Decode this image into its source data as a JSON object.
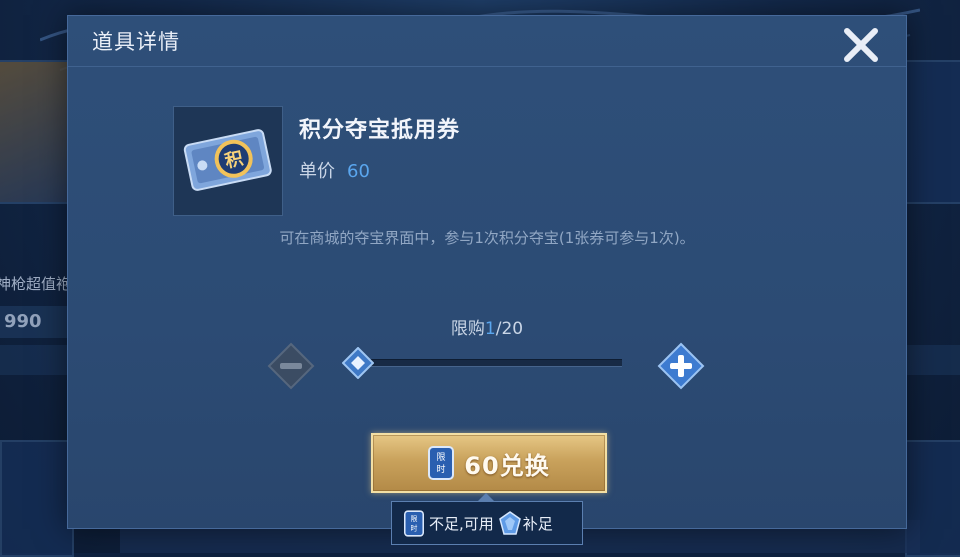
{
  "dialog": {
    "title": "道具详情",
    "close_icon": "close-x-icon"
  },
  "item": {
    "name": "积分夺宝抵用券",
    "price_label": "单价",
    "price_value": "60",
    "icon": "points-ticket-icon",
    "icon_char": "积",
    "description": "可在商城的夺宝界面中，参与1次积分夺宝(1张券可参与1次)。"
  },
  "purchase": {
    "limit_label": "限购",
    "limit_current": "1",
    "limit_total": "/20",
    "quantity_min": 1,
    "quantity_max": 20,
    "quantity_value": 1
  },
  "exchange": {
    "label": "60兑换",
    "coupon_icon": "limited-coupon-icon",
    "coupon_chars": "限时"
  },
  "tooltip": {
    "text_before": "不足,可用",
    "text_after": "补足",
    "gem_icon": "gem-icon"
  },
  "background": {
    "promo_text": "神枪超值袍",
    "promo_price": "990"
  },
  "colors": {
    "accent_blue": "#5aa6ee",
    "gold_button": "#c9a25c",
    "dialog_bg": "#2c4b74"
  }
}
